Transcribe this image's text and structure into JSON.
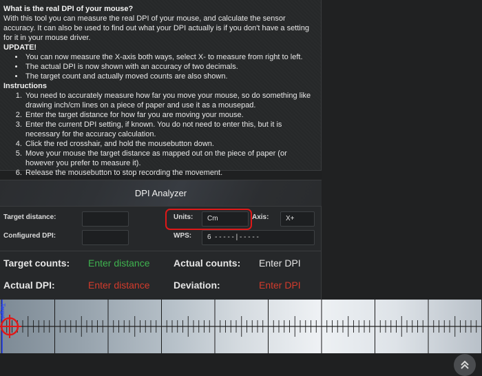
{
  "info": {
    "title": "What is the real DPI of your mouse?",
    "intro": "With this tool you can measure the real DPI of your mouse, and calculate the sensor accuracy. It can also be used to find out what your DPI actually is if you don't have a setting for it in your mouse driver.",
    "update_heading": "UPDATE!",
    "updates": [
      "You can now measure the X-axis both ways, select X- to measure from right to left.",
      "The actual DPI is now shown with an accuracy of two decimals.",
      "The target count and actually moved counts are also shown."
    ],
    "instructions_heading": "Instructions",
    "instructions": [
      "You need to accurately measure how far you move your mouse, so do something like drawing inch/cm lines on a piece of paper and use it as a mousepad.",
      "Enter the target distance for how far you are moving your mouse.",
      "Enter the current DPI setting, if known. You do not need to enter this, but it is necessary for the accuracy calculation.",
      "Click the red crosshair, and hold the mousebutton down.",
      "Move your mouse the target distance as mapped out on the piece of paper (or however you prefer to measure it).",
      "Release the mousebutton to stop recording the movement."
    ]
  },
  "analyzer": {
    "title": "DPI Analyzer",
    "target_distance_label": "Target distance:",
    "target_distance_value": "",
    "configured_dpi_label": "Configured DPI:",
    "configured_dpi_value": "",
    "units_label": "Units:",
    "units_value": "Cm",
    "axis_label": "Axis:",
    "axis_value": "X+",
    "wps_label": "WPS:",
    "wps_value": "6  - - - - - | - - - - -",
    "target_counts_label": "Target counts:",
    "target_counts_value": "Enter distance",
    "actual_counts_label": "Actual counts:",
    "actual_counts_value": "Enter DPI",
    "actual_dpi_label": "Actual DPI:",
    "actual_dpi_value": "Enter distance",
    "deviation_label": "Deviation:",
    "deviation_value": "Enter DPI"
  },
  "ruler": {
    "target_label": "Target"
  },
  "colors": {
    "green": "#3fb34f",
    "red": "#d33b2c",
    "highlight": "#e01818",
    "target_blue": "#1e3cff"
  },
  "icons": {
    "scroll_top": "double-chevron-up-icon",
    "crosshair": "crosshair-icon"
  }
}
